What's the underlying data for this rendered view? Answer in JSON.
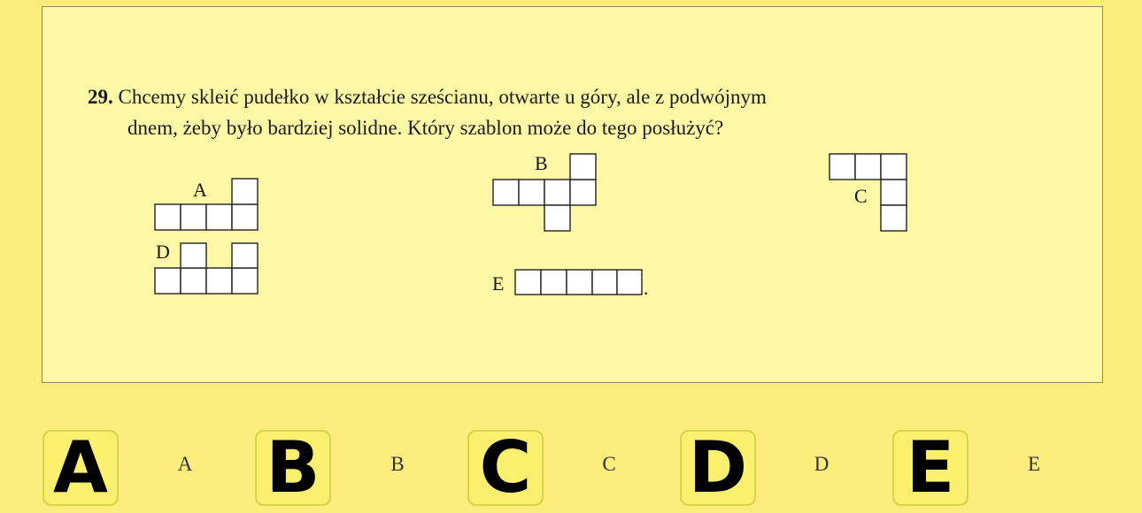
{
  "question": {
    "number": "29.",
    "line1": "Chcemy skleić pudełko w kształcie sześcianu, otwarte u góry, ale z podwójnym",
    "line2": "dnem, żeby było bardziej solidne. Który szablon może do tego posłużyć?"
  },
  "figures": {
    "A": {
      "label": "A"
    },
    "B": {
      "label": "B"
    },
    "C": {
      "label": "C"
    },
    "D": {
      "label": "D"
    },
    "E": {
      "label": "E",
      "trailing": "."
    }
  },
  "answers": [
    {
      "button": "A",
      "caption": "A"
    },
    {
      "button": "B",
      "caption": "B"
    },
    {
      "button": "C",
      "caption": "C"
    },
    {
      "button": "D",
      "caption": "D"
    },
    {
      "button": "E",
      "caption": "E"
    }
  ],
  "colors": {
    "page_background": "#fced7d",
    "panel_background": "#fcf8a6",
    "button_background": "#faef6e",
    "button_border": "#d8d448"
  }
}
